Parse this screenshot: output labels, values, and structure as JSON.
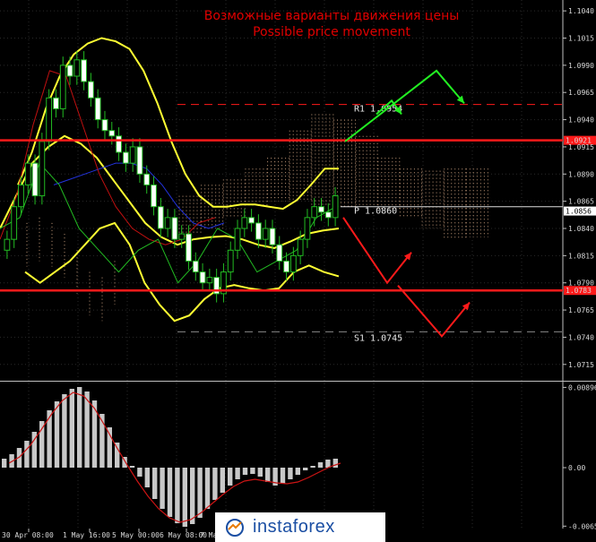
{
  "title_ru": "Возможные варианты движения цены",
  "title_en": "Possible price movement",
  "logo_text": "instaforex",
  "colors": {
    "resistance": "#ff1a1a",
    "support_line": "#ff1a1a",
    "bands": "#ffff33",
    "up_arrow": "#22ee22",
    "down_arrow": "#ff1a1a",
    "pivot": "#dddddd",
    "macd_hist": "#c8c8c8",
    "macd_signal": "#cc1414"
  },
  "chart_data": [
    {
      "type": "line",
      "name": "price-panel",
      "ylim": [
        1.07,
        1.105
      ],
      "y_ticks": [
        "1.1040",
        "1.1015",
        "1.0990",
        "1.0965",
        "1.0940",
        "1.0915",
        "1.0890",
        "1.0865",
        "1.0840",
        "1.0815",
        "1.0790",
        "1.0765",
        "1.0740",
        "1.0715"
      ],
      "x_ticks": [
        "30 Apr 08:00",
        "1 May 16:00",
        "5 May 00:00",
        "6 May 08:00",
        "7 May"
      ],
      "current_price_label": "1.0856",
      "current_price": 1.0856,
      "horizontal_lines": [
        {
          "label": "R1  1.0954",
          "value": 1.0954,
          "style": "dashed"
        },
        {
          "label": "",
          "value": 1.0921,
          "style": "solid",
          "tag": "1.0921"
        },
        {
          "label": "P  1.0860",
          "value": 1.086,
          "style": "solid"
        },
        {
          "label": "",
          "value": 1.0783,
          "style": "solid",
          "tag": "1.0783"
        },
        {
          "label": "S1  1.0745",
          "value": 1.0745,
          "style": "dashed"
        }
      ],
      "candles_close": [
        1.083,
        1.086,
        1.088,
        1.09,
        1.087,
        1.092,
        1.096,
        1.095,
        1.099,
        1.098,
        1.0995,
        1.0975,
        1.096,
        1.094,
        1.093,
        1.0925,
        1.091,
        1.09,
        1.0915,
        1.089,
        1.088,
        1.086,
        1.084,
        1.085,
        1.083,
        1.0835,
        1.081,
        1.08,
        1.079,
        1.0795,
        1.078,
        1.08,
        1.082,
        1.084,
        1.085,
        1.0845,
        1.083,
        1.084,
        1.0825,
        1.081,
        1.08,
        1.0815,
        1.083,
        1.085,
        1.086,
        1.0855,
        1.085,
        1.087
      ],
      "upper_band": [
        1.088,
        1.091,
        1.095,
        1.098,
        1.1,
        1.101,
        1.1015,
        1.1012,
        1.1005,
        1.0985,
        1.0955,
        1.092,
        1.089,
        1.087,
        1.086,
        1.086,
        1.0862,
        1.0862,
        1.086,
        1.0858,
        1.0866,
        1.088,
        1.0895,
        1.0895
      ],
      "middle_band": [
        1.084,
        1.087,
        1.09,
        1.0915,
        1.0925,
        1.0918,
        1.0905,
        1.0885,
        1.0865,
        1.0845,
        1.0832,
        1.0825,
        1.083,
        1.0832,
        1.0833,
        1.083,
        1.0825,
        1.0822,
        1.0828,
        1.0835,
        1.0838,
        1.084
      ],
      "lower_band": [
        1.08,
        1.079,
        1.08,
        1.081,
        1.0825,
        1.084,
        1.0845,
        1.0825,
        1.079,
        1.077,
        1.0755,
        1.076,
        1.0775,
        1.0785,
        1.0788,
        1.0785,
        1.0783,
        1.0785,
        1.08,
        1.0806,
        1.08,
        1.0796
      ],
      "scenarios": [
        {
          "direction": "up",
          "path": [
            1.092,
            1.0985,
            1.0955
          ]
        },
        {
          "direction": "up_small",
          "path": [
            1.0945,
            1.0955,
            1.0945
          ]
        },
        {
          "direction": "down",
          "path": [
            1.085,
            1.079,
            1.0818
          ]
        },
        {
          "direction": "down_deep",
          "path": [
            1.079,
            1.0745,
            1.0772
          ]
        }
      ]
    },
    {
      "type": "bar",
      "name": "macd-panel",
      "ylim": [
        -0.0068,
        0.0092
      ],
      "y_ticks": [
        "0.00896",
        "0.00",
        "-0.00653"
      ],
      "values": [
        0.001,
        0.0015,
        0.0022,
        0.003,
        0.004,
        0.0052,
        0.0064,
        0.0074,
        0.0082,
        0.0088,
        0.009,
        0.0085,
        0.0075,
        0.006,
        0.0045,
        0.0028,
        0.0012,
        0.0002,
        -0.001,
        -0.0022,
        -0.0035,
        -0.0046,
        -0.0055,
        -0.0062,
        -0.0066,
        -0.0063,
        -0.0056,
        -0.0046,
        -0.0036,
        -0.0028,
        -0.002,
        -0.0013,
        -0.0008,
        -0.0007,
        -0.001,
        -0.0016,
        -0.002,
        -0.0018,
        -0.0013,
        -0.0008,
        -0.0003,
        0.0002,
        0.0006,
        0.0009,
        0.001
      ],
      "signal": [
        0.0005,
        0.0012,
        0.0025,
        0.0042,
        0.006,
        0.0075,
        0.0084,
        0.008,
        0.0066,
        0.0046,
        0.0024,
        0.0004,
        -0.0015,
        -0.0032,
        -0.0046,
        -0.0056,
        -0.0061,
        -0.0058,
        -0.005,
        -0.004,
        -0.003,
        -0.0021,
        -0.0015,
        -0.0013,
        -0.0015,
        -0.0017,
        -0.0018,
        -0.0016,
        -0.0011,
        -0.0005,
        0.0001,
        0.0005
      ]
    }
  ]
}
